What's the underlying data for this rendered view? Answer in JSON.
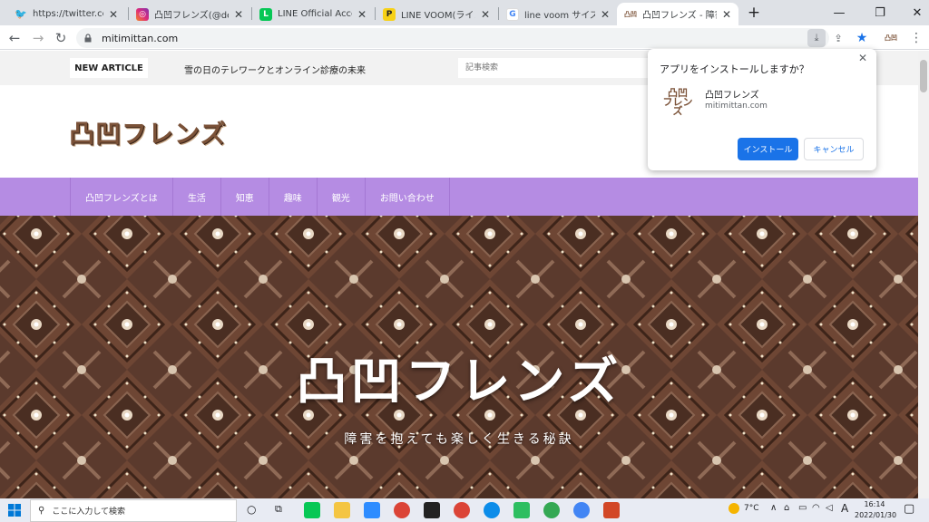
{
  "tabs": [
    {
      "title": "https://twitter.com/i",
      "favicon": "twitter-icon",
      "color": "#1da1f2"
    },
    {
      "title": "凸凹フレンズ(@dekob",
      "favicon": "instagram-icon",
      "color": "#d6249f"
    },
    {
      "title": "LINE Official Accoun",
      "favicon": "line-icon",
      "color": "#06c755"
    },
    {
      "title": "LINE VOOM(ラインブ",
      "favicon": "p-icon",
      "color": "#f7d117"
    },
    {
      "title": "line voom サイズ - Go",
      "favicon": "google-icon",
      "color": "#4285f4"
    },
    {
      "title": "凸凹フレンズ - 障害を",
      "favicon": "site-icon",
      "color": "#7b5238"
    }
  ],
  "new_tab": "+",
  "address": "mitimittan.com",
  "site": {
    "new_article_label": "NEW ARTICLE",
    "ticker": "雪の日のテレワークとオンライン診療の未来",
    "search_placeholder": "記事検索",
    "logo": "凸凹フレンズ",
    "nav": [
      "凸凹フレンズとは",
      "生活",
      "知恵",
      "趣味",
      "観光",
      "お問い合わせ"
    ],
    "hero_title": "凸凹フレンズ",
    "hero_subtitle": "障害を抱えても楽しく生きる秘訣"
  },
  "popup": {
    "title": "アプリをインストールしますか？",
    "app_name": "凸凹フレンズ",
    "app_domain": "mitimittan.com",
    "install_label": "インストール",
    "cancel_label": "キャンセル",
    "icon_text": "凸凹 フレンズ"
  },
  "taskbar": {
    "search_placeholder": "ここに入力して検索",
    "temperature": "7°C",
    "ime": "A",
    "time": "16:14",
    "date": "2022/01/30"
  },
  "colors": {
    "accent": "#b58ce3",
    "install": "#1a73e8",
    "brand_brown": "#7b5238"
  }
}
